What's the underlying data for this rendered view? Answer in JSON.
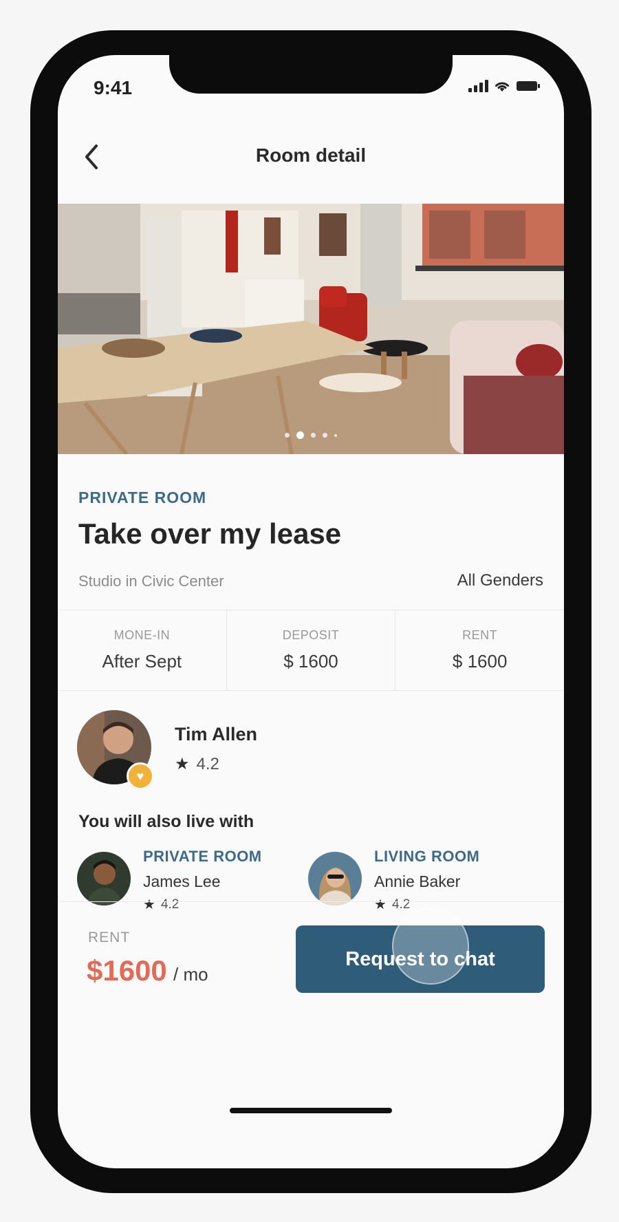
{
  "status_bar": {
    "time": "9:41"
  },
  "header": {
    "title": "Room detail",
    "back_icon": "chevron-left-icon"
  },
  "gallery": {
    "image_count": 5,
    "active_index": 1
  },
  "listing": {
    "room_type": "PRIVATE ROOM",
    "title": "Take over my lease",
    "subtitle": "Studio in Civic Center",
    "gender": "All Genders"
  },
  "stats": [
    {
      "label": "MONE-IN",
      "value": "After Sept"
    },
    {
      "label": "DEPOSIT",
      "value": "$ 1600"
    },
    {
      "label": "RENT",
      "value": "$ 1600"
    }
  ],
  "host": {
    "name": "Tim Allen",
    "rating": "4.2",
    "badge_icon": "heart-icon"
  },
  "roommates_section": {
    "title": "You will also live with",
    "items": [
      {
        "room_type": "PRIVATE ROOM",
        "name": "James Lee",
        "rating": "4.2"
      },
      {
        "room_type": "LIVING ROOM",
        "name": "Annie Baker",
        "rating": "4.2"
      }
    ]
  },
  "footer": {
    "rent_label": "RENT",
    "rent_price": "$1600",
    "rent_unit": "/ mo",
    "cta_label": "Request to chat"
  },
  "colors": {
    "accent_blue": "#2e5c79",
    "label_blue": "#3d6a88",
    "price_red": "#e26a56",
    "badge_yellow": "#f1b23c"
  }
}
